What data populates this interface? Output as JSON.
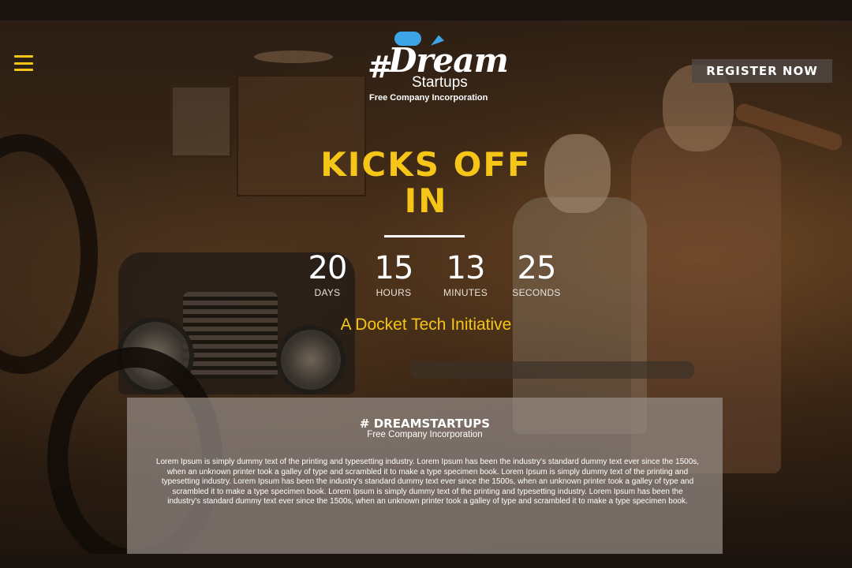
{
  "colors": {
    "accent": "#f5c518",
    "logo_blue": "#3da5e6",
    "panel": "#968c87",
    "background": "#2a1d13"
  },
  "header": {
    "menu_icon": "hamburger-icon",
    "logo": {
      "hash": "#",
      "word": "Dream",
      "startups": "Startups",
      "tagline": "Free Company Incorporation"
    },
    "register_label": "REGISTER NOW"
  },
  "hero": {
    "headline_line1": "KICKS OFF",
    "headline_line2": "IN",
    "countdown": [
      {
        "value": "20",
        "label": "DAYS"
      },
      {
        "value": "15",
        "label": "HOURS"
      },
      {
        "value": "13",
        "label": "MINUTES"
      },
      {
        "value": "25",
        "label": "SECONDS"
      }
    ],
    "initiative": "A Docket Tech Initiative"
  },
  "info": {
    "title": "# DREAMSTARTUPS",
    "subtitle": "Free Company Incorporation",
    "body": "Lorem Ipsum is simply dummy text of the printing and typesetting industry. Lorem Ipsum has been the industry's standard dummy text ever since the 1500s, when an unknown printer took a galley of type and scrambled it to make a type specimen book. Lorem Ipsum is simply dummy text of the printing and typesetting industry. Lorem Ipsum has been the industry's standard dummy text ever since the 1500s, when an unknown printer took a galley of type and scrambled it to make a type specimen book. Lorem Ipsum is simply dummy text of the printing and typesetting industry. Lorem Ipsum has been the industry's standard dummy text ever since the 1500s, when an unknown printer took a galley of type and scrambled it to make a type specimen book."
  }
}
